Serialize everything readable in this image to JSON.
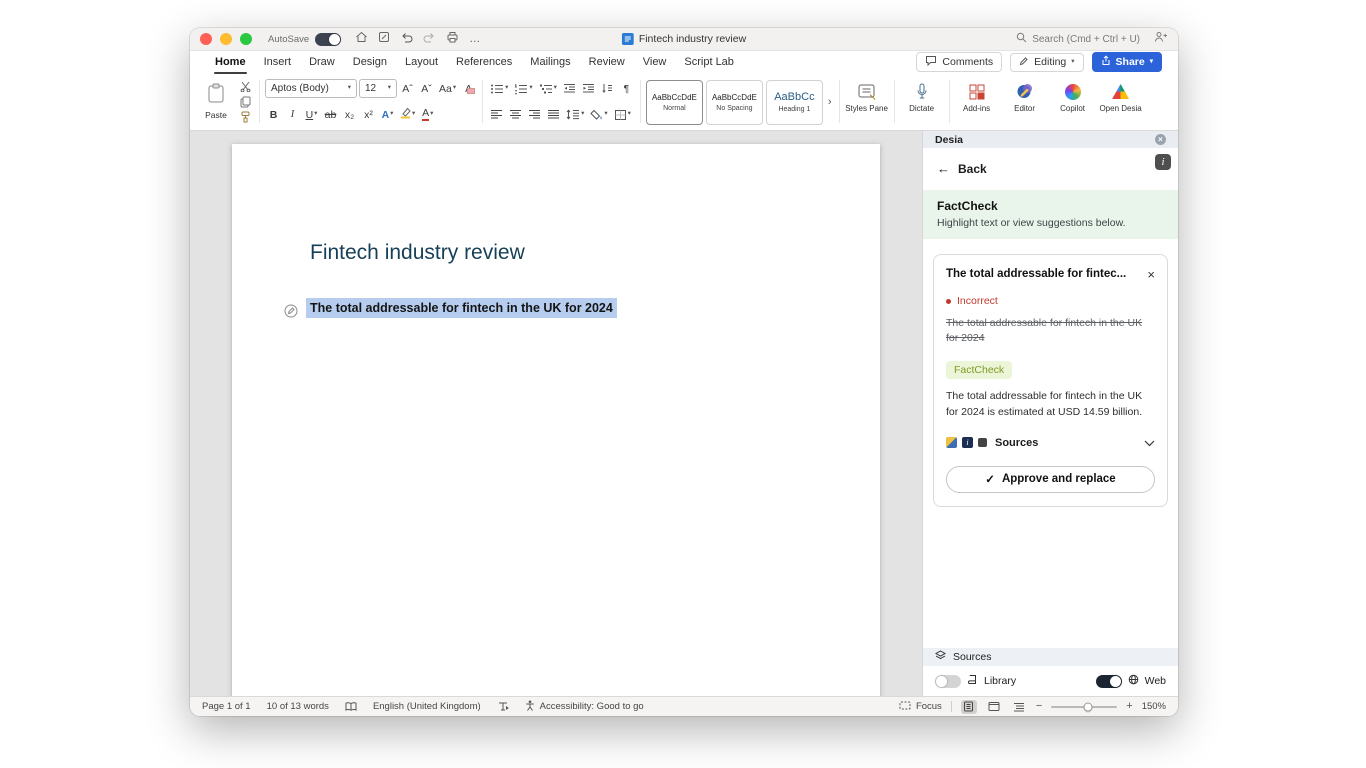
{
  "titlebar": {
    "autosave_label": "AutoSave",
    "document_title": "Fintech industry review",
    "search_placeholder": "Search (Cmd + Ctrl + U)"
  },
  "icons": {
    "caret": "▾",
    "more": "…",
    "back_arrow": "←",
    "check": "✓",
    "close": "×",
    "info": "i",
    "pilcrow": "¶",
    "gallery_more": "›",
    "minus": "−",
    "plus": "+"
  },
  "ribbon": {
    "tabs": [
      {
        "label": "Home"
      },
      {
        "label": "Insert"
      },
      {
        "label": "Draw"
      },
      {
        "label": "Design"
      },
      {
        "label": "Layout"
      },
      {
        "label": "References"
      },
      {
        "label": "Mailings"
      },
      {
        "label": "Review"
      },
      {
        "label": "View"
      },
      {
        "label": "Script Lab"
      }
    ],
    "comments_label": "Comments",
    "editing_label": "Editing",
    "share_label": "Share",
    "paste_label": "Paste",
    "font_name": "Aptos (Body)",
    "font_size": "12",
    "format": {
      "grow": "Aˆ",
      "shrink": "Aˇ",
      "aa": "Aa",
      "clear": "A",
      "bold": "B",
      "italic": "I",
      "underline": "U",
      "strikethrough": "ab",
      "subscript": "x₂",
      "superscript": "x²",
      "effects": "A",
      "color": "A"
    },
    "styles": [
      {
        "preview": "AaBbCcDdE",
        "name": "Normal"
      },
      {
        "preview": "AaBbCcDdE",
        "name": "No Spacing"
      },
      {
        "preview": "AaBbCc",
        "name": "Heading 1"
      }
    ],
    "styles_pane_label": "Styles Pane",
    "dictate_label": "Dictate",
    "addins_label": "Add-ins",
    "editor_label": "Editor",
    "copilot_label": "Copilot",
    "open_desia_label": "Open Desia"
  },
  "document": {
    "title": "Fintech industry review",
    "selected_text": "The total addressable for fintech in the UK for 2024"
  },
  "sidebar": {
    "panel_title": "Desia",
    "back_label": "Back",
    "factcheck_heading": "FactCheck",
    "factcheck_subtitle": "Highlight text or view suggestions below.",
    "card": {
      "title": "The total addressable for fintec...",
      "status_label": "Incorrect",
      "original_text": "The total addressable for fintech in the UK for 2024",
      "badge_label": "FactCheck",
      "suggestion_text": "The total addressable for fintech in the UK for 2024 is estimated at USD 14.59 billion.",
      "sources_label": "Sources",
      "approve_label": "Approve and replace"
    },
    "footer": {
      "sources_label": "Sources",
      "library_label": "Library",
      "web_label": "Web"
    }
  },
  "statusbar": {
    "page": "Page 1 of 1",
    "words": "10 of 13 words",
    "language": "English (United Kingdom)",
    "accessibility": "Accessibility: Good to go",
    "focus_label": "Focus",
    "zoom_level": "150%"
  },
  "colors": {
    "share_button_blue": "#2c63d9",
    "selection_highlight": "#b6cdf0",
    "incorrect_red": "#c2392f",
    "factcheck_badge_bg": "#ecf5d7",
    "factcheck_badge_text": "#7f9b27",
    "factcheck_banner_bg": "#e9f5ea",
    "doc_title_color": "#173f57"
  }
}
